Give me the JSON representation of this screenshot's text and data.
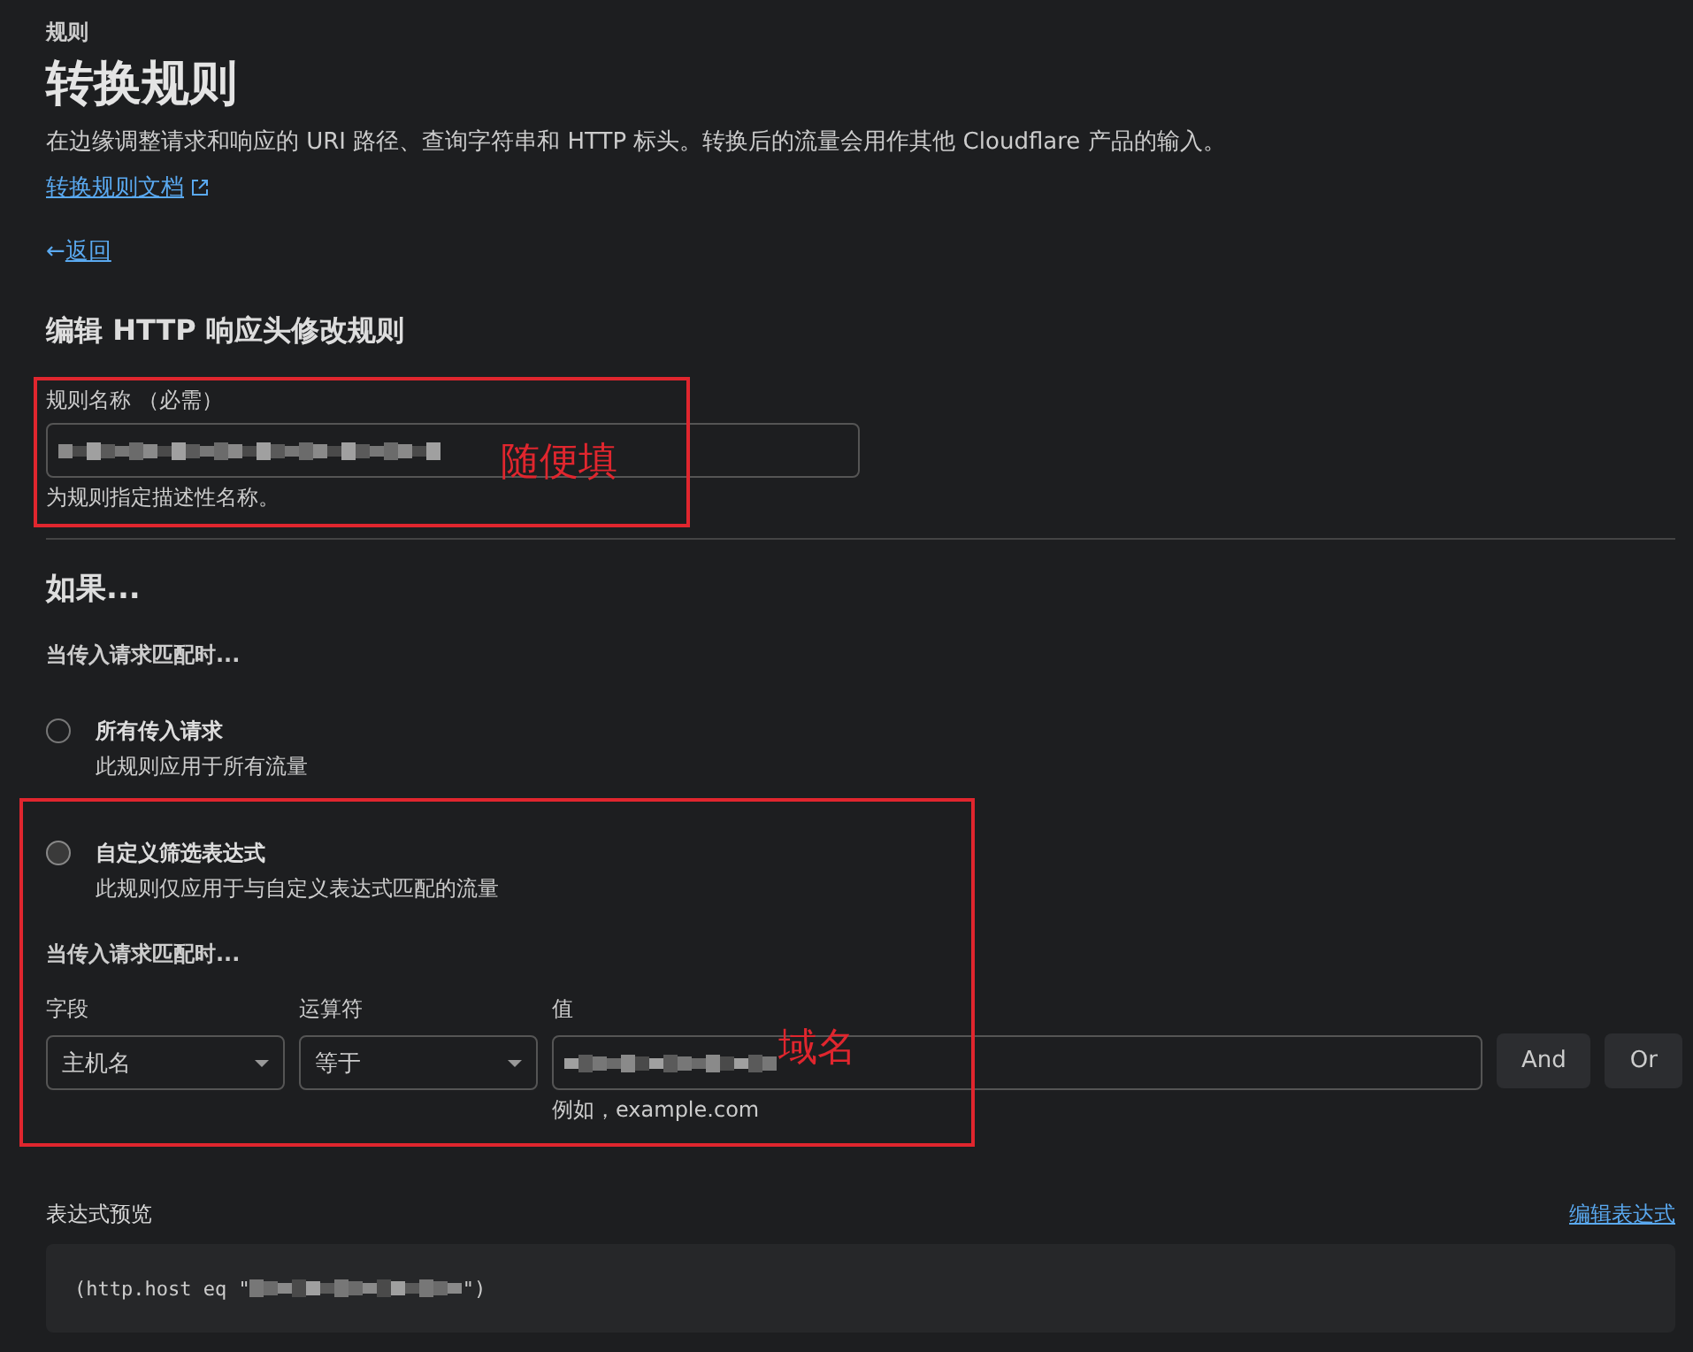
{
  "breadcrumb": "规则",
  "title": "转换规则",
  "description": "在边缘调整请求和响应的 URI 路径、查询字符串和 HTTP 标头。转换后的流量会用作其他 Cloudflare 产品的输入。",
  "docs_link": "转换规则文档",
  "back_arrow": "←",
  "back_link": "返回",
  "section_title": "编辑 HTTP 响应头修改规则",
  "rule_name": {
    "label": "规则名称 （必需）",
    "hint": "为规则指定描述性名称。"
  },
  "annotations": [
    {
      "text": "随便填"
    },
    {
      "text": "域名"
    }
  ],
  "if_title": "如果...",
  "match_label": "当传入请求匹配时...",
  "options": [
    {
      "title": "所有传入请求",
      "description": "此规则应用于所有流量",
      "selected": false
    },
    {
      "title": "自定义筛选表达式",
      "description": "此规则仅应用于与自定义表达式匹配的流量",
      "selected": true
    }
  ],
  "custom_match_label": "当传入请求匹配时...",
  "columns": [
    {
      "label": "字段",
      "value": "主机名"
    },
    {
      "label": "运算符",
      "value": "等于"
    },
    {
      "label": "值",
      "hint": "例如，example.com"
    }
  ],
  "buttons": [
    "And",
    "Or"
  ],
  "preview": {
    "label": "表达式预览",
    "edit_link": "编辑表达式",
    "prefix": "(http.host eq \"",
    "suffix": "\")"
  }
}
